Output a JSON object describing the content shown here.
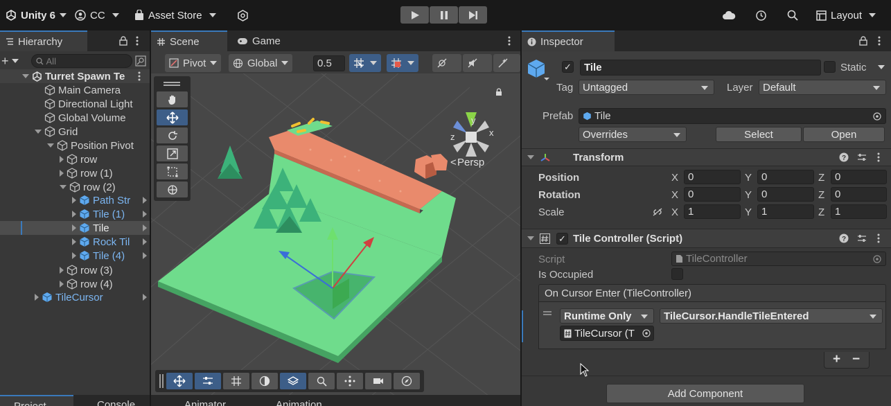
{
  "topbar": {
    "unity": "Unity 6",
    "account": "CC",
    "asset_store": "Asset Store",
    "layout": "Layout"
  },
  "hierarchy": {
    "tab": "Hierarchy",
    "search_placeholder": "All",
    "scene": "Turret Spawn Te",
    "items": {
      "main_camera": "Main Camera",
      "directional_light": "Directional Light",
      "global_volume": "Global Volume",
      "grid": "Grid",
      "position_pivot": "Position Pivot",
      "row": "row",
      "row1": "row (1)",
      "row2": "row (2)",
      "path_str": "Path Str",
      "tile1": "Tile (1)",
      "tile": "Tile",
      "rock_til": "Rock Til",
      "tile4": "Tile (4)",
      "row3": "row (3)",
      "row4": "row (4)",
      "tile_cursor": "TileCursor"
    }
  },
  "scene": {
    "tab_scene": "Scene",
    "tab_game": "Game",
    "pivot": "Pivot",
    "global": "Global",
    "snap_value": "0.5",
    "persp": "Persp",
    "gizmo_x": "x",
    "gizmo_y": "y",
    "gizmo_z": "z"
  },
  "bottom_tabs": [
    "Project",
    "Console",
    "Animator",
    "Animation"
  ],
  "inspector": {
    "tab": "Inspector",
    "object_name": "Tile",
    "static_label": "Static",
    "tag_label": "Tag",
    "tag_value": "Untagged",
    "layer_label": "Layer",
    "layer_value": "Default",
    "prefab_label": "Prefab",
    "prefab_value": "Tile",
    "overrides": "Overrides",
    "select": "Select",
    "open": "Open",
    "transform": {
      "title": "Transform",
      "position_label": "Position",
      "rotation_label": "Rotation",
      "scale_label": "Scale",
      "x": "X",
      "y": "Y",
      "z": "Z",
      "position": [
        "0",
        "0",
        "0"
      ],
      "rotation": [
        "0",
        "0",
        "0"
      ],
      "scale": [
        "1",
        "1",
        "1"
      ]
    },
    "tile_controller": {
      "title": "Tile Controller (Script)",
      "script_label": "Script",
      "script_value": "TileController",
      "occupied_label": "Is Occupied",
      "event_header": "On Cursor Enter (TileController)",
      "runtime": "Runtime Only",
      "handler": "TileCursor.HandleTileEntered",
      "target": "TileCursor (T",
      "plus": "+",
      "minus": "−"
    },
    "add_component": "Add Component"
  },
  "colors": {
    "accent": "#3a79bb",
    "grass": "#6fdc8c",
    "path": "#e98a6c"
  }
}
